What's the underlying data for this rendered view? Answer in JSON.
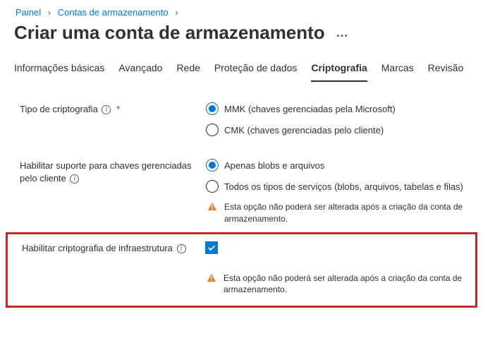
{
  "breadcrumb": {
    "items": [
      {
        "label": "Painel"
      },
      {
        "label": "Contas de armazenamento"
      }
    ]
  },
  "page": {
    "title": "Criar uma conta de armazenamento",
    "more": "…"
  },
  "tabs": [
    {
      "label": "Informações básicas",
      "active": false
    },
    {
      "label": "Avançado",
      "active": false
    },
    {
      "label": "Rede",
      "active": false
    },
    {
      "label": "Proteção de dados",
      "active": false
    },
    {
      "label": "Criptografia",
      "active": true
    },
    {
      "label": "Marcas",
      "active": false
    },
    {
      "label": "Revisão",
      "active": false
    }
  ],
  "encryption_type": {
    "label": "Tipo de criptografia",
    "required": "*",
    "options": [
      {
        "label": "MMK (chaves gerenciadas pela Microsoft)",
        "selected": true
      },
      {
        "label": "CMK (chaves gerenciadas pelo cliente)",
        "selected": false
      }
    ]
  },
  "cmk_support": {
    "label": "Habilitar suporte para chaves gerenciadas pelo cliente",
    "options": [
      {
        "label": "Apenas blobs e arquivos",
        "selected": true
      },
      {
        "label": "Todos os tipos de serviços (blobs, arquivos, tabelas e filas)",
        "selected": false
      }
    ],
    "warning": "Esta opção não poderá ser alterada após a criação da conta de armazenamento."
  },
  "infra_encryption": {
    "label": "Habilitar criptografia de infraestrutura",
    "checked": true,
    "warning": "Esta opção não poderá ser alterada após a criação da conta de armazenamento."
  },
  "icons": {
    "info": "i"
  }
}
